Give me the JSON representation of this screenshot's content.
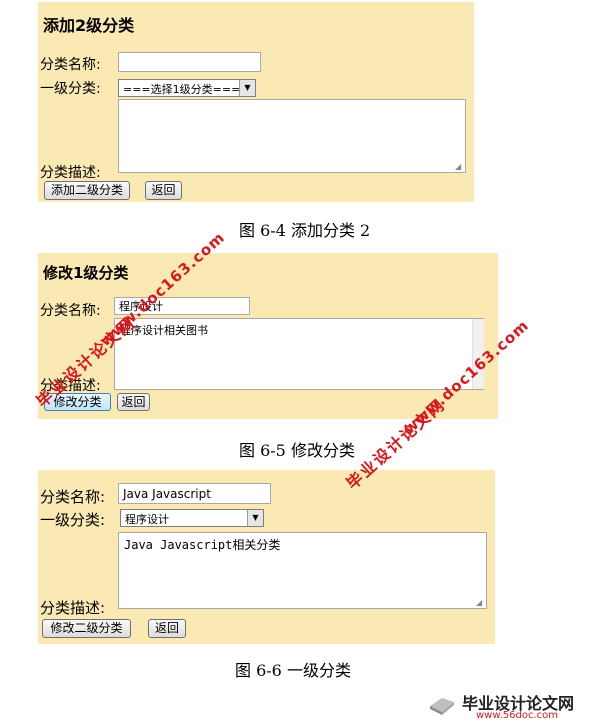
{
  "figure1": {
    "title": "添加2级分类",
    "name_label": "分类名称:",
    "name_value": "",
    "parent_label": "一级分类:",
    "parent_selected": "===选择1级分类===",
    "desc_label": "分类描述:",
    "desc_value": "",
    "submit_label": "添加二级分类",
    "back_label": "返回",
    "caption": "图 6-4 添加分类 2"
  },
  "figure2": {
    "title": "修改1级分类",
    "name_label": "分类名称:",
    "name_value": "程序设计",
    "desc_label": "分类描述:",
    "desc_value": "程序设计相关图书",
    "submit_label": "修改分类",
    "back_label": "返回",
    "caption": "图 6-5 修改分类"
  },
  "figure3": {
    "name_label": "分类名称:",
    "name_value": "Java Javascript",
    "parent_label": "一级分类:",
    "parent_selected": "程序设计",
    "desc_label": "分类描述:",
    "desc_value": "Java Javascript相关分类",
    "submit_label": "修改二级分类",
    "back_label": "返回",
    "caption": "图 6-6 一级分类"
  },
  "watermarks": {
    "url": "www.doc163.com",
    "site_name": "毕业设计论文网",
    "footer_site_name": "毕业设计论文网",
    "footer_url": "www.56doc.com"
  },
  "colors": {
    "panel_bg": "#fbe9b4",
    "watermark_red": "#d7191c"
  }
}
